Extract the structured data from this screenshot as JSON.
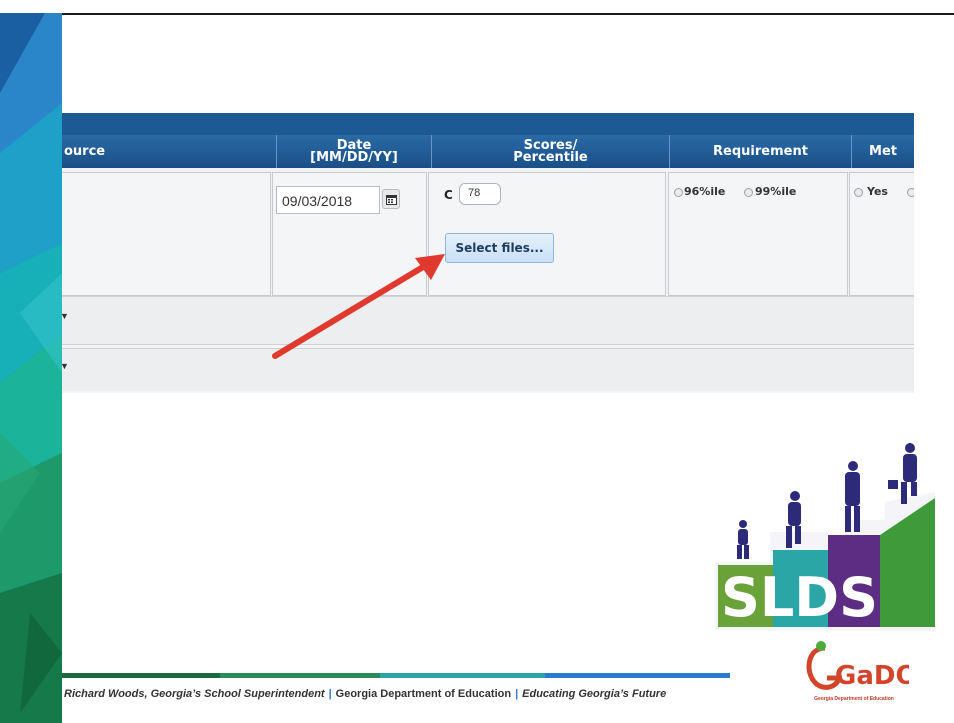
{
  "table": {
    "headers": [
      {
        "label_line1": "ource",
        "label_line2": ""
      },
      {
        "label_line1": "Date",
        "label_line2": "[MM/DD/YY]"
      },
      {
        "label_line1": "Scores/",
        "label_line2": "Percentile"
      },
      {
        "label_line1": "Requirement",
        "label_line2": ""
      },
      {
        "label_line1": "Met",
        "label_line2": ""
      }
    ],
    "date_value": "09/03/2018",
    "score_prefix": "C",
    "score_value": "78",
    "select_files_label": "Select files...",
    "requirement_options": [
      "96%ile",
      "99%ile"
    ],
    "met_options": [
      "Yes"
    ]
  },
  "footer": {
    "superintendent": "Richard Woods, Georgia’s School Superintendent",
    "department": "Georgia Department of Education",
    "tagline": "Educating Georgia’s Future"
  },
  "logos": {
    "slds_text": "SLDS",
    "gadoe_text": "GaDOE",
    "gadoe_subtitle": "Georgia Department of Education"
  },
  "colors": {
    "header_blue": "#1d5a94",
    "arrow_red": "#e03a2e",
    "slds_green": "#6aa23a",
    "slds_teal": "#2aa6a6",
    "slds_purple": "#5c2d83",
    "gadoe_red": "#d2452a"
  }
}
